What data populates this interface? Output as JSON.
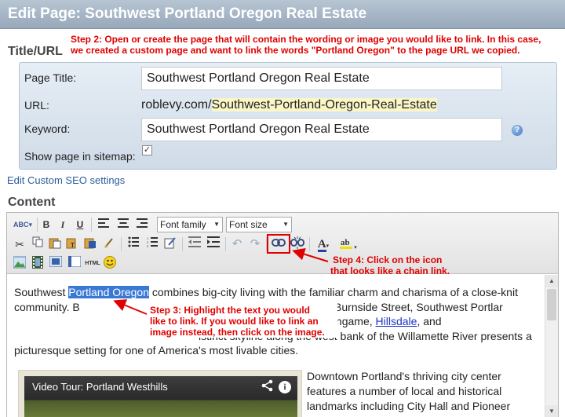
{
  "header": {
    "title": "Edit Page: Southwest Portland Oregon Real Estate"
  },
  "steps": {
    "step2_line1": "Step 2: Open or create the page that will contain the wording or image you would like to link.  In this case,",
    "step2_line2": "we created a custom page and want to link the words \"Portland Oregon\" to the page URL we copied.",
    "step3_line1": "Step 3: Highlight the text you would",
    "step3_line2": "like to link.  If you would like to link an",
    "step3_line3": "image instead, then click on the image.",
    "step4_line1": "Step 4: Click on the icon",
    "step4_line2": "that looks like a chain link."
  },
  "title_url": {
    "section_label": "Title/URL",
    "page_title_label": "Page Title:",
    "page_title_value": "Southwest Portland Oregon Real Estate",
    "url_label": "URL:",
    "url_domain": "roblevy.com/",
    "url_slug": "Southwest-Portland-Oregon-Real-Estate",
    "keyword_label": "Keyword:",
    "keyword_value": "Southwest Portland Oregon Real Estate",
    "help_icon": "question-mark",
    "sitemap_label": "Show page in sitemap:",
    "sitemap_checked": true,
    "checkbox_mark": "✓"
  },
  "seo_link": "Edit Custom SEO settings",
  "content": {
    "section_label": "Content",
    "toolbar": {
      "font_family": "Font family",
      "font_size": "Font size",
      "bold": "B",
      "italic": "I",
      "underline": "U",
      "html": "HTML",
      "text_color": "A"
    },
    "paragraph1": {
      "t1": "Southwest ",
      "selected": "Portland Oregon",
      "t2": " combines big-city living with the familiar charm and charisma of a close-knit community. B",
      "t3": "d stretching south from Burnside Street, Southwest Portlar",
      "t4": " neighborhoods, including South Burlingame, ",
      "link": "Hillsdale",
      "t5": ", and",
      "t6": "istinct skyline along the west bank of the Willamette River presents a picturesque setting for one of America's most livable cities."
    },
    "video_title": "Video Tour: Portland Westhills",
    "paragraph2": "Downtown Portland's thriving city center features a number of local and historical landmarks including City Hall and Pioneer"
  }
}
